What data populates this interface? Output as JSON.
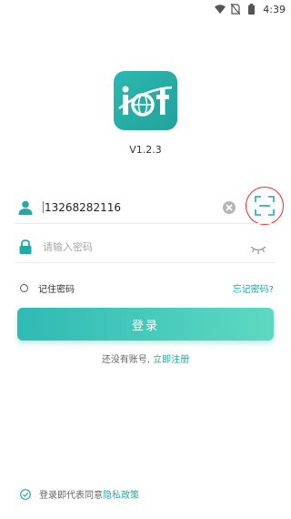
{
  "status_bar": {
    "time": "4:39",
    "icons": [
      "wifi-icon",
      "no-sim-icon",
      "battery-icon"
    ]
  },
  "app": {
    "logo_icon": "iot-logo",
    "version": "V1.2.3",
    "accent_color": "#22aaa3"
  },
  "login": {
    "phone_value": "13268282116",
    "phone_icon": "user-icon",
    "clear_icon": "clear-icon",
    "scan_icon": "scan-icon",
    "password_placeholder": "请输入密码",
    "password_icon": "lock-icon",
    "toggle_icon": "eye-closed-icon",
    "remember_label": "记住密码",
    "forgot_label": "忘记密码?",
    "submit_label": "登录"
  },
  "register": {
    "prompt": "还没有账号, ",
    "link_label": "立即注册"
  },
  "policy": {
    "prefix": "登录即代表同意",
    "link_label": "隐私政策",
    "checked": true
  }
}
